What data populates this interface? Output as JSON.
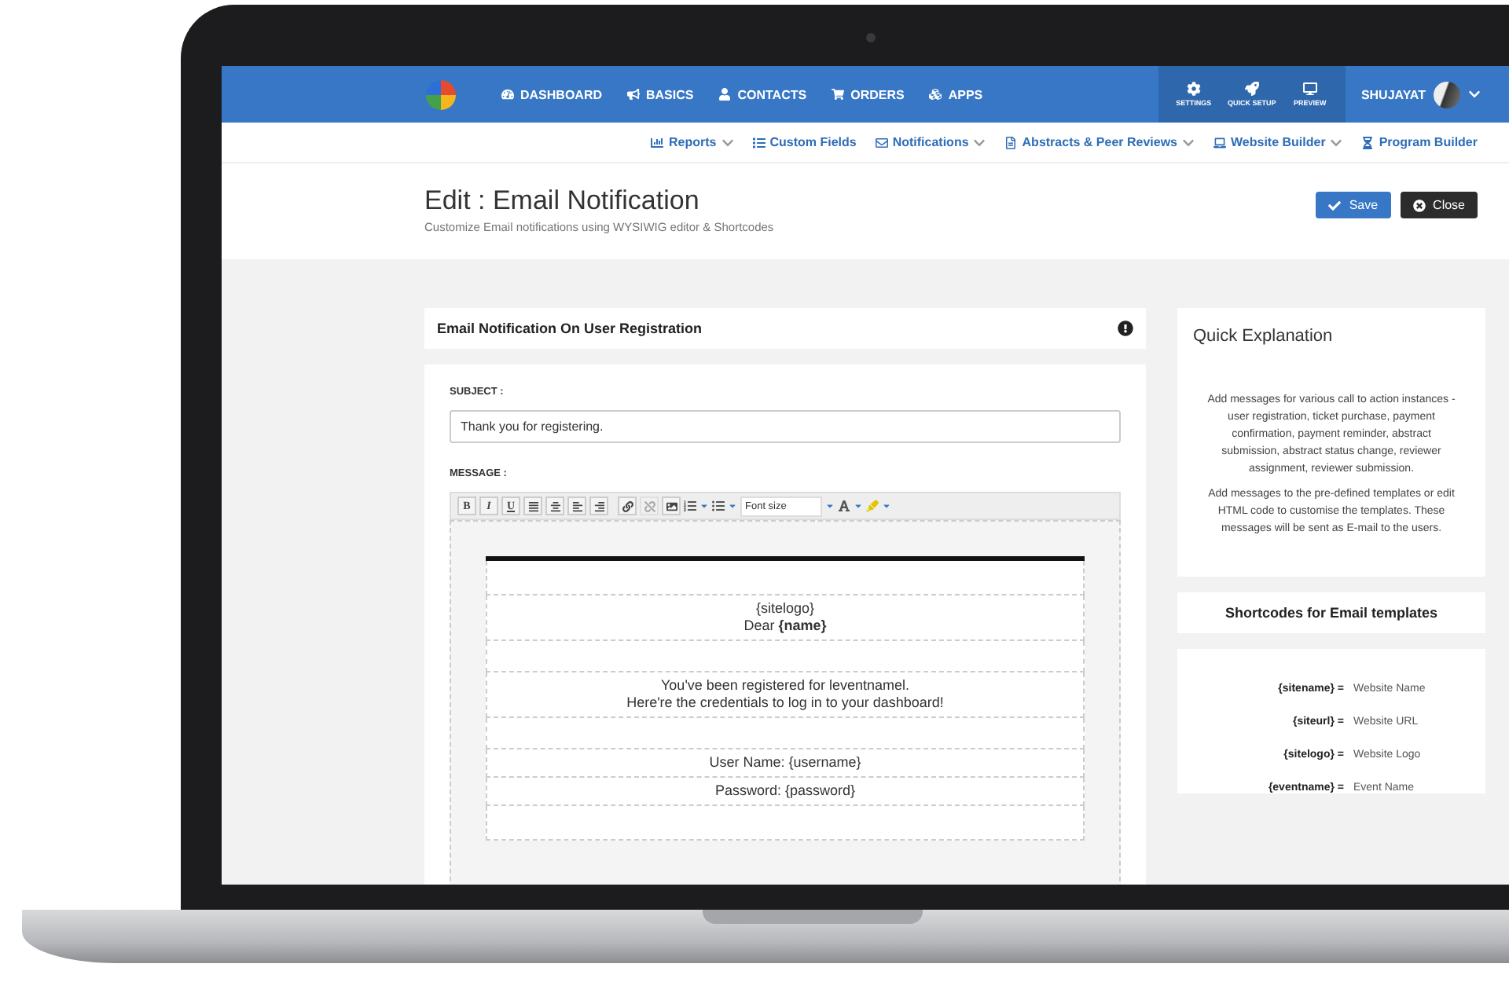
{
  "nav": {
    "items": [
      {
        "label": "DASHBOARD"
      },
      {
        "label": "BASICS"
      },
      {
        "label": "CONTACTS"
      },
      {
        "label": "ORDERS"
      },
      {
        "label": "APPS"
      }
    ],
    "tools": [
      {
        "label": "SETTINGS"
      },
      {
        "label": "QUICK SETUP"
      },
      {
        "label": "PREVIEW"
      }
    ],
    "user": "SHUJAYAT"
  },
  "subnav": [
    {
      "label": "Reports",
      "dropdown": true
    },
    {
      "label": "Custom Fields",
      "dropdown": false
    },
    {
      "label": "Notifications",
      "dropdown": true
    },
    {
      "label": "Abstracts & Peer Reviews",
      "dropdown": true
    },
    {
      "label": "Website Builder",
      "dropdown": true
    },
    {
      "label": "Program Builder",
      "dropdown": false
    }
  ],
  "header": {
    "title": "Edit : Email Notification",
    "subtitle": "Customize Email notifications using WYSIWIG editor & Shortcodes",
    "buttons": [
      {
        "label": "Save",
        "kind": "primary"
      },
      {
        "label": "Close",
        "kind": "dark"
      }
    ]
  },
  "form": {
    "title": "Email Notification On User Registration",
    "subject_label": "SUBJECT :",
    "subject": "Thank you for registering.",
    "message_label": "MESSAGE :",
    "toolbar": {
      "format": [
        "B",
        "I",
        "U"
      ],
      "font_size_placeholder": "Font size"
    },
    "email_rows": [
      [
        "{sitelogo}",
        "Dear **{name}**"
      ],
      [
        "You've been registered for leventnamel.",
        "Here're the credentials to log in to your dashboard!"
      ],
      [
        "User Name: {username}"
      ],
      [
        "Password: {password}"
      ]
    ]
  },
  "explanation": {
    "title": "Quick Explanation",
    "paragraphs": [
      "Add messages for various call to action instances - user registration, ticket purchase, payment confirmation, payment reminder, abstract submission, abstract status change, reviewer assignment, reviewer submission.",
      "Add messages to the pre-defined templates or edit HTML code to customise the templates. These messages will be sent as E-mail to the users."
    ]
  },
  "shortcodes": {
    "title": "Shortcodes for Email templates",
    "items": [
      {
        "code": "{sitename} =",
        "meaning": "Website Name"
      },
      {
        "code": "{siteurl} =",
        "meaning": "Website URL"
      },
      {
        "code": "{sitelogo} =",
        "meaning": "Website Logo"
      },
      {
        "code": "{eventname} =",
        "meaning": "Event Name"
      }
    ]
  }
}
